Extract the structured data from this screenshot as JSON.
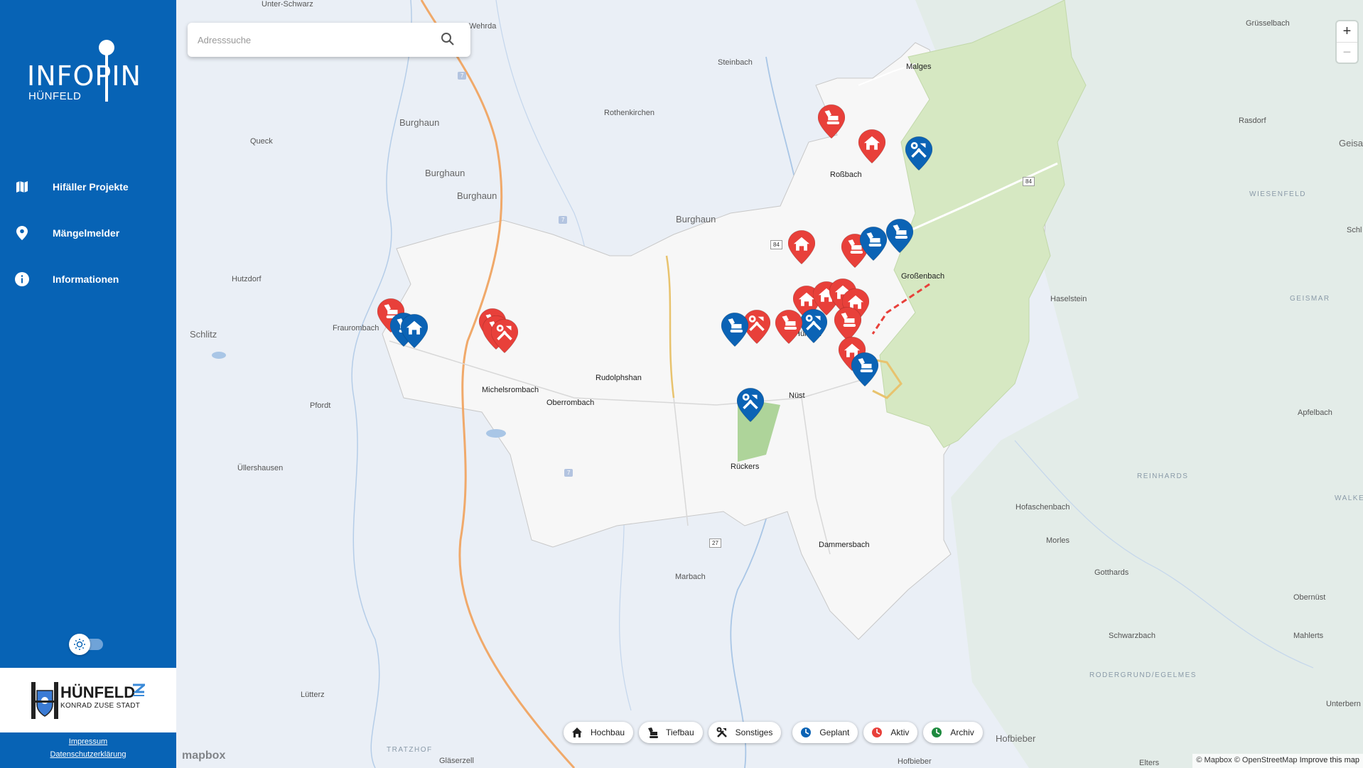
{
  "app": {
    "logo_title": "INFOPIN",
    "logo_subtitle": "HÜNFELD"
  },
  "sidebar": {
    "items": [
      {
        "label": "Hifäller Projekte",
        "icon": "map-icon"
      },
      {
        "label": "Mängelmelder",
        "icon": "location-pin-icon"
      },
      {
        "label": "Informationen",
        "icon": "info-icon"
      }
    ],
    "city_name": "HÜNFELD",
    "city_tagline": "KONRAD ZUSE STADT",
    "footer": {
      "impressum": "Impressum",
      "datenschutz": "Datenschutzerklärung"
    }
  },
  "search": {
    "placeholder": "Adresssuche",
    "icon": "search-icon"
  },
  "zoom": {
    "in": "+",
    "out": "−"
  },
  "places": [
    {
      "name": "Unter-Schwarz",
      "cls": ""
    },
    {
      "name": "Wehrda",
      "cls": ""
    },
    {
      "name": "Steinbach",
      "cls": ""
    },
    {
      "name": "Rothenkirchen",
      "cls": ""
    },
    {
      "name": "Burghaun",
      "cls": "big"
    },
    {
      "name": "Burghaun",
      "cls": "big"
    },
    {
      "name": "Burghaun",
      "cls": "big"
    },
    {
      "name": "Burghaun",
      "cls": "big"
    },
    {
      "name": "Queck",
      "cls": ""
    },
    {
      "name": "Hutzdorf",
      "cls": ""
    },
    {
      "name": "Schlitz",
      "cls": "big"
    },
    {
      "name": "Fraurombach",
      "cls": ""
    },
    {
      "name": "Pfordt",
      "cls": ""
    },
    {
      "name": "Üllershausen",
      "cls": ""
    },
    {
      "name": "Marbach",
      "cls": ""
    },
    {
      "name": "Lütterz",
      "cls": ""
    },
    {
      "name": "TRATZHOF",
      "cls": "region"
    },
    {
      "name": "Gläserzell",
      "cls": ""
    },
    {
      "name": "Malges",
      "cls": "dark"
    },
    {
      "name": "Roßbach",
      "cls": "dark"
    },
    {
      "name": "Großenbach",
      "cls": "dark"
    },
    {
      "name": "Hünfeld",
      "cls": "dark"
    },
    {
      "name": "Michelsrombach",
      "cls": "dark"
    },
    {
      "name": "Oberrombach",
      "cls": "dark"
    },
    {
      "name": "Rudolphshan",
      "cls": "dark"
    },
    {
      "name": "Nüst",
      "cls": "dark"
    },
    {
      "name": "Rückers",
      "cls": "dark"
    },
    {
      "name": "Dammersbach",
      "cls": "dark"
    },
    {
      "name": "Grüsselbach",
      "cls": ""
    },
    {
      "name": "Rasdorf",
      "cls": ""
    },
    {
      "name": "Geisa",
      "cls": "big"
    },
    {
      "name": "WIESENFELD",
      "cls": "region"
    },
    {
      "name": "Haselstein",
      "cls": ""
    },
    {
      "name": "GEISMAR",
      "cls": "region"
    },
    {
      "name": "Apfelbach",
      "cls": ""
    },
    {
      "name": "REINHARDS",
      "cls": "region"
    },
    {
      "name": "Hofaschenbach",
      "cls": ""
    },
    {
      "name": "Morles",
      "cls": ""
    },
    {
      "name": "Gotthards",
      "cls": ""
    },
    {
      "name": "Obernüst",
      "cls": ""
    },
    {
      "name": "Schwarzbach",
      "cls": ""
    },
    {
      "name": "Mahlerts",
      "cls": ""
    },
    {
      "name": "RODERGRUND/EGELMES",
      "cls": "region"
    },
    {
      "name": "Hofbieber",
      "cls": "big"
    },
    {
      "name": "Unterbern",
      "cls": ""
    },
    {
      "name": "Hofbieber",
      "cls": ""
    },
    {
      "name": "Elters",
      "cls": ""
    },
    {
      "name": "Schl",
      "cls": ""
    },
    {
      "name": "WALKE",
      "cls": "region"
    }
  ],
  "road_labels": [
    "7",
    "7",
    "7",
    "84",
    "84",
    "27"
  ],
  "pins": [
    {
      "status": "aktiv",
      "type": "tiefbau"
    },
    {
      "status": "aktiv",
      "type": "hochbau"
    },
    {
      "status": "geplant",
      "type": "sonstiges"
    },
    {
      "status": "aktiv",
      "type": "hochbau"
    },
    {
      "status": "aktiv",
      "type": "tiefbau"
    },
    {
      "status": "geplant",
      "type": "tiefbau"
    },
    {
      "status": "geplant",
      "type": "tiefbau"
    },
    {
      "status": "aktiv",
      "type": "hochbau"
    },
    {
      "status": "aktiv",
      "type": "hochbau"
    },
    {
      "status": "aktiv",
      "type": "hochbau"
    },
    {
      "status": "aktiv",
      "type": "hochbau"
    },
    {
      "status": "aktiv",
      "type": "tiefbau"
    },
    {
      "status": "geplant",
      "type": "sonstiges"
    },
    {
      "status": "aktiv",
      "type": "tiefbau"
    },
    {
      "status": "aktiv",
      "type": "hochbau"
    },
    {
      "status": "geplant",
      "type": "tiefbau"
    },
    {
      "status": "aktiv",
      "type": "sonstiges"
    },
    {
      "status": "geplant",
      "type": "tiefbau"
    },
    {
      "status": "geplant",
      "type": "sonstiges"
    },
    {
      "status": "aktiv",
      "type": "tiefbau"
    },
    {
      "status": "geplant",
      "type": "tiefbau"
    },
    {
      "status": "geplant",
      "type": "hochbau"
    },
    {
      "status": "aktiv",
      "type": "tiefbau"
    },
    {
      "status": "aktiv",
      "type": "tiefbau"
    },
    {
      "status": "aktiv",
      "type": "sonstiges"
    }
  ],
  "legend": [
    {
      "label": "Hochbau",
      "icon": "house-icon"
    },
    {
      "label": "Tiefbau",
      "icon": "excavator-icon"
    },
    {
      "label": "Sonstiges",
      "icon": "tools-icon"
    },
    {
      "label": "Geplant",
      "icon": "clock-blue-icon",
      "color": "#0b63b5"
    },
    {
      "label": "Aktiv",
      "icon": "clock-red-icon",
      "color": "#e8403a"
    },
    {
      "label": "Archiv",
      "icon": "clock-green-icon",
      "color": "#1e8a3f"
    }
  ],
  "colors": {
    "aktiv": "#e8403a",
    "geplant": "#0b63b5",
    "archiv": "#1e8a3f",
    "sidebar": "#0763b5"
  },
  "attribution": {
    "mapbox": "© Mapbox",
    "osm": "© OpenStreetMap",
    "improve": "Improve this map",
    "logo": "mapbox"
  }
}
